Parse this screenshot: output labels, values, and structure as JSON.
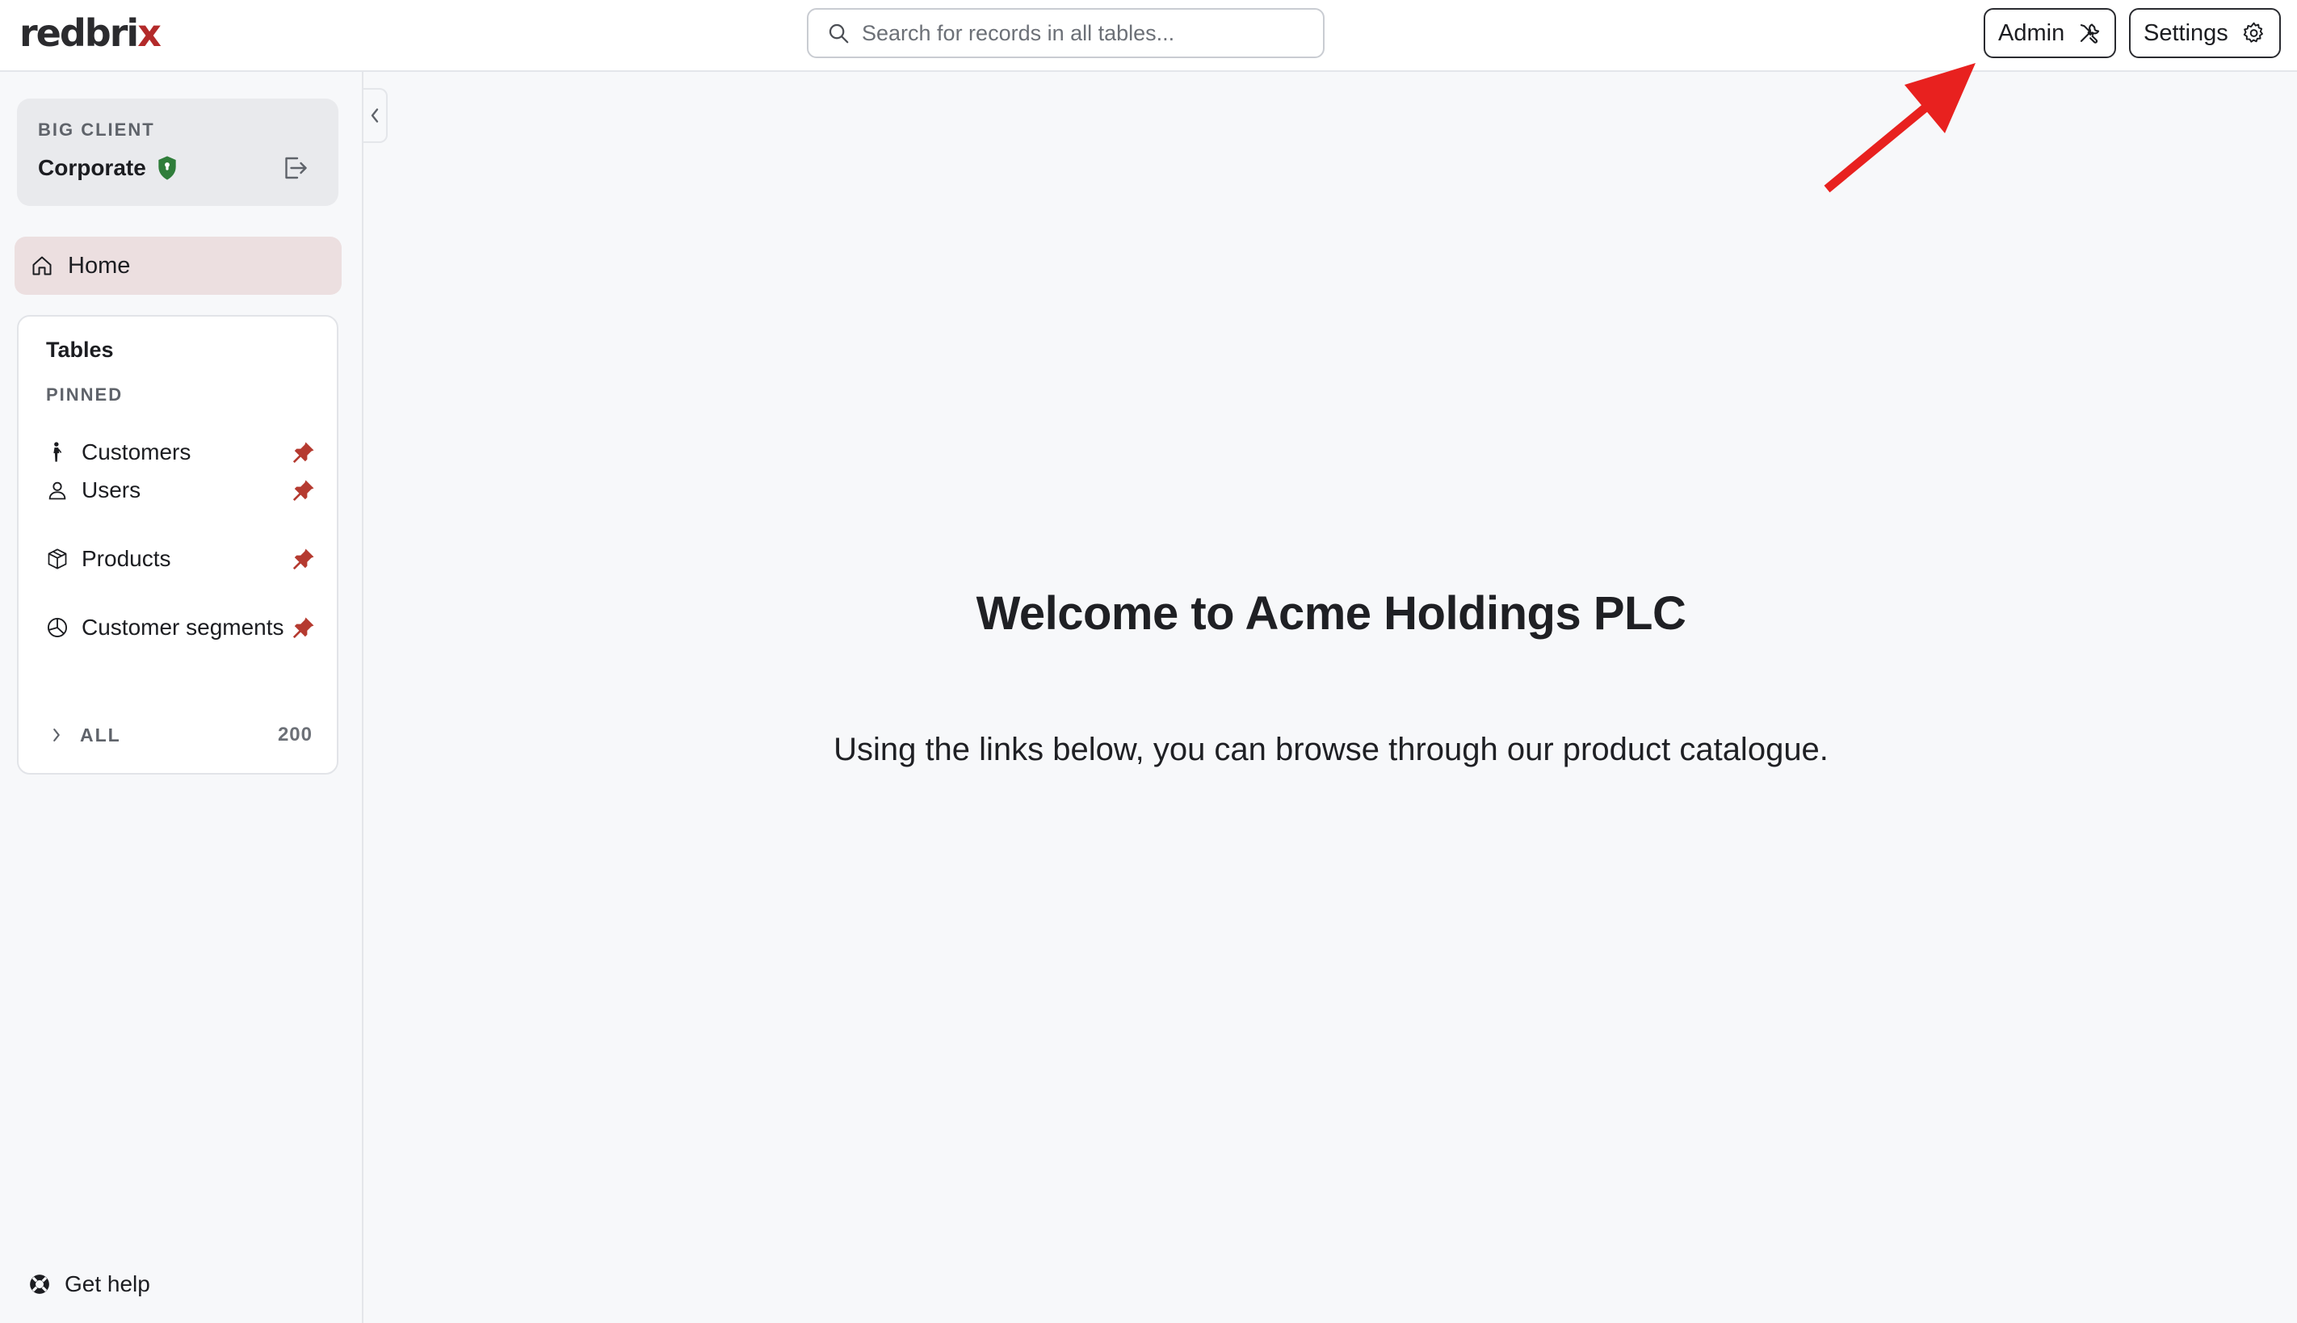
{
  "brand": {
    "logo_main": "redbri",
    "logo_x": "x",
    "accent_color": "#b32a2a"
  },
  "header": {
    "search": {
      "placeholder": "Search for records in all tables...",
      "value": ""
    },
    "admin_label": "Admin",
    "settings_label": "Settings"
  },
  "sidebar": {
    "client": {
      "label": "BIG CLIENT",
      "name": "Corporate",
      "badge_icon": "shield-icon"
    },
    "home_label": "Home",
    "tables": {
      "title": "Tables",
      "pinned_label": "PINNED",
      "items": [
        {
          "label": "Customers",
          "icon": "person-walking-icon",
          "pinned": true
        },
        {
          "label": "Users",
          "icon": "user-icon",
          "pinned": true
        },
        {
          "label": "Products",
          "icon": "box-icon",
          "pinned": true
        },
        {
          "label": "Customer segments",
          "icon": "pie-chart-icon",
          "pinned": true
        }
      ],
      "all_label": "ALL",
      "all_count": "200"
    },
    "help_label": "Get help"
  },
  "main": {
    "title": "Welcome to Acme Holdings PLC",
    "subtitle": "Using the links below, you can browse through our product catalogue."
  }
}
